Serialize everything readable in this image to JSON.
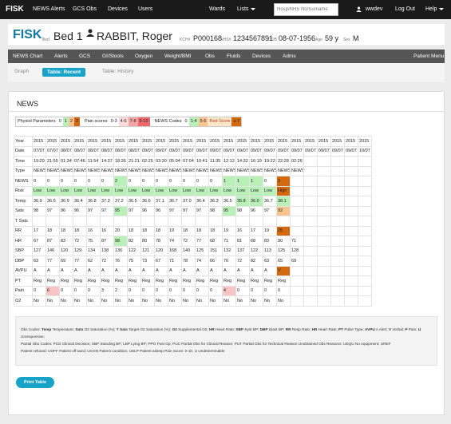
{
  "topnav": {
    "brand": "FISK",
    "items": [
      "NEWS Alerts",
      "GCS Obs",
      "Devices",
      "Users"
    ],
    "wards": "Wards",
    "lists": "Lists",
    "search_placeholder": "Hosp/NHS No/Surname",
    "user": "wwdev",
    "logout": "Log Out",
    "help": "Help"
  },
  "patient": {
    "brand": "FISK",
    "bed_label": "Bed",
    "bed": "Bed 1",
    "name": "RABBIT, Roger",
    "kch_label": "KCH#",
    "kch": "P000168",
    "nhs_label": "NHS#",
    "nhs": "1234567891",
    "dob_label": "DOB",
    "dob": "08-07-1956",
    "age_label": "Age",
    "age": "59 y",
    "sex_label": "Sex",
    "sex": "M"
  },
  "patient_nav": {
    "items": [
      "NEWS Chart",
      "Alerts",
      "GCS",
      "GI/Stools",
      "Oxygen",
      "Weight/BMI",
      "Obs",
      "Fluids",
      "Devices",
      "Adms"
    ],
    "menu": "Patient Menu"
  },
  "view_tabs": {
    "graph": "Graph",
    "recent": "Table: Recent",
    "history": "Table: History"
  },
  "section_title": "NEWS",
  "legend": {
    "physio_label": "Physiol Parameters",
    "physio": [
      "0",
      "1",
      "2",
      "3"
    ],
    "pain_label": "Pain scores",
    "pain": [
      "0-3",
      "4-6",
      "7-8",
      "9-10"
    ],
    "news_label": "NEWS Codes",
    "news": [
      "0",
      "1-4",
      "5-6",
      "Red Score",
      "≥ 7"
    ]
  },
  "table": {
    "rows": [
      {
        "label": "Year",
        "cells": [
          "2015",
          "2015",
          "2015",
          "2015",
          "2015",
          "2015",
          "2015",
          "2015",
          "2015",
          "2015",
          "2015",
          "2015",
          "2015",
          "2015",
          "2015",
          "2015",
          "2015",
          "2015",
          "2015",
          "2015",
          "2015",
          "2015",
          "2015",
          "2015",
          "2015"
        ]
      },
      {
        "label": "Date",
        "cells": [
          "07/07",
          "07/07",
          "08/07",
          "08/07",
          "08/07",
          "08/07",
          "08/07",
          "08/07",
          "09/07",
          "09/07",
          "09/07",
          "09/07",
          "09/07",
          "09/07",
          "09/07",
          "09/07",
          "09/07",
          "09/07",
          "09/07",
          "09/07",
          "09/07",
          "09/07",
          "09/07",
          "09/07",
          "10/07"
        ]
      },
      {
        "label": "Time",
        "cells": [
          "19:29",
          "21:55",
          "01:34",
          "07:46",
          "11:54",
          "14:37",
          "18:36",
          "21:21",
          "02:25",
          "03:30",
          "05:04",
          "07:04",
          "10:41",
          "11:35",
          "12:12",
          "14:32",
          "16:19",
          "19:22",
          "22:28",
          "02:26",
          "",
          "",
          "",
          "",
          ""
        ]
      },
      {
        "label": "Type",
        "cells": [
          "NEWS",
          "NEWS",
          "NEWS",
          "NEWS",
          "NEWS",
          "NEWS",
          "NEWS",
          "NEWS",
          "NEWS",
          "NEWS",
          "NEWS",
          "NEWS",
          "NEWS",
          "NEWS",
          "NEWS",
          "NEWS",
          "NEWS",
          "NEWS",
          "NEWS",
          "NEWS",
          "",
          "",
          "",
          "",
          ""
        ]
      },
      {
        "label": "NEWS",
        "cells": [
          "0",
          "0",
          "0",
          "0",
          "0",
          "0",
          "2",
          "0",
          "0",
          "0",
          "0",
          "0",
          "0",
          "0",
          "1",
          "1",
          "1",
          "0",
          "3",
          "",
          "",
          "",
          "",
          "",
          ""
        ]
      },
      {
        "label": "Risk",
        "cells": [
          "Low",
          "Low",
          "Low",
          "Low",
          "Low",
          "Low",
          "Low",
          "Low",
          "Low",
          "Low",
          "Low",
          "Low",
          "Low",
          "Low",
          "Low",
          "Low",
          "Low",
          "Low",
          "High",
          "",
          "",
          "",
          "",
          "",
          ""
        ]
      },
      {
        "label": "Temp",
        "cells": [
          "36.9",
          "36.6",
          "36.9",
          "36.4",
          "36.8",
          "37.3",
          "37.2",
          "36.5",
          "36.6",
          "37.1",
          "36.7",
          "37.0",
          "36.4",
          "36.3",
          "36.5",
          "35.8",
          "36.0",
          "36.7",
          "38.1",
          "",
          "",
          "",
          "",
          "",
          ""
        ]
      },
      {
        "label": "Sats",
        "cells": [
          "98",
          "97",
          "96",
          "96",
          "97",
          "97",
          "95",
          "97",
          "96",
          "96",
          "97",
          "97",
          "97",
          "98",
          "95",
          "98",
          "96",
          "97",
          "92",
          "",
          "",
          "",
          "",
          "",
          ""
        ]
      },
      {
        "label": "T Sats",
        "cells": [
          "",
          "",
          "",
          "",
          "",
          "",
          "",
          "",
          "",
          "",
          "",
          "",
          "",
          "",
          "",
          "",
          "",
          "",
          "",
          "",
          "",
          "",
          "",
          "",
          ""
        ]
      },
      {
        "label": "RR",
        "cells": [
          "17",
          "18",
          "18",
          "18",
          "16",
          "16",
          "20",
          "18",
          "18",
          "18",
          "19",
          "18",
          "18",
          "18",
          "19",
          "16",
          "17",
          "19",
          "25",
          "",
          "",
          "",
          "",
          "",
          ""
        ]
      },
      {
        "label": "HR",
        "cells": [
          "67",
          "87",
          "83",
          "72",
          "75",
          "87",
          "98",
          "82",
          "80",
          "78",
          "74",
          "72",
          "77",
          "68",
          "71",
          "81",
          "68",
          "83",
          "90",
          "71",
          "",
          "",
          "",
          "",
          ""
        ]
      },
      {
        "label": "SBP",
        "cells": [
          "127",
          "146",
          "120",
          "129",
          "134",
          "138",
          "136",
          "122",
          "121",
          "120",
          "168",
          "140",
          "125",
          "151",
          "132",
          "137",
          "122",
          "113",
          "125",
          "128",
          "",
          "",
          "",
          "",
          ""
        ]
      },
      {
        "label": "DBP",
        "cells": [
          "63",
          "77",
          "69",
          "77",
          "62",
          "72",
          "76",
          "75",
          "73",
          "67",
          "71",
          "78",
          "74",
          "66",
          "76",
          "72",
          "82",
          "63",
          "65",
          "69",
          "",
          "",
          "",
          "",
          ""
        ]
      },
      {
        "label": "AVPU",
        "cells": [
          "A",
          "A",
          "A",
          "A",
          "A",
          "A",
          "A",
          "A",
          "A",
          "A",
          "A",
          "A",
          "A",
          "A",
          "A",
          "A",
          "A",
          "A",
          "V",
          "",
          "",
          "",
          "",
          "",
          ""
        ]
      },
      {
        "label": "PT",
        "cells": [
          "Reg",
          "Reg",
          "Reg",
          "Reg",
          "Reg",
          "Reg",
          "Reg",
          "Reg",
          "Reg",
          "Reg",
          "Reg",
          "Reg",
          "Reg",
          "Reg",
          "Reg",
          "Reg",
          "Reg",
          "Reg",
          "Reg",
          "",
          "",
          "",
          "",
          "",
          ""
        ]
      },
      {
        "label": "Pain",
        "cells": [
          "0",
          "6",
          "0",
          "0",
          "0",
          "3",
          "2",
          "0",
          "0",
          "0",
          "0",
          "0",
          "0",
          "0",
          "4",
          "0",
          "0",
          "0",
          "0",
          "",
          "",
          "",
          "",
          "",
          ""
        ]
      },
      {
        "label": "O2",
        "cells": [
          "No",
          "No",
          "No",
          "No",
          "No",
          "No",
          "No",
          "No",
          "No",
          "No",
          "No",
          "No",
          "No",
          "No",
          "No",
          "No",
          "No",
          "No",
          "No",
          "",
          "",
          "",
          "",
          "",
          ""
        ]
      }
    ]
  },
  "notes": {
    "intro": "Obs Codes:",
    "items": [
      [
        "Temp",
        "Temperature"
      ],
      [
        "Sats",
        "O2 Saturation (%)"
      ],
      [
        "T Sats",
        "Target O2 Saturation (%)"
      ],
      [
        "O2",
        "Supplemental O2"
      ],
      [
        "HR",
        "Heart Rate"
      ],
      [
        "SBP",
        "Syst BP"
      ],
      [
        "DBP",
        "Diast BP"
      ],
      [
        "RR",
        "Resp Rate"
      ],
      [
        "HR",
        "Heart Rate"
      ],
      [
        "PT",
        "Pulse Type"
      ],
      [
        "AVPU",
        "A Alert"
      ],
      [
        "V",
        "Verbal"
      ],
      [
        "P",
        "Pain"
      ],
      [
        "U",
        "Unresponsive"
      ]
    ],
    "line2": "Partial Obs Codes: PCD Clinical Decision; SBP Standing BP; LBP Lying BP; PPO Post Op; PUC Partial Obs for Clinical Reason; PUT Partial Obs for Technical Reason Unobtained Obs Reasons: UEQU No equipment; UREF",
    "line3": "Patient refused; UOFF Patient off ward; UCON Patient condition; USLP Patient asleep Pain Score: 0-10, U Undeterminable"
  },
  "print_label": "Print Table",
  "colors": {
    "accent": "#17a2c8",
    "brand": "#1178a3",
    "green": "#b8f0b8",
    "red": "#f8c4c4",
    "orange": "#d2690f"
  }
}
